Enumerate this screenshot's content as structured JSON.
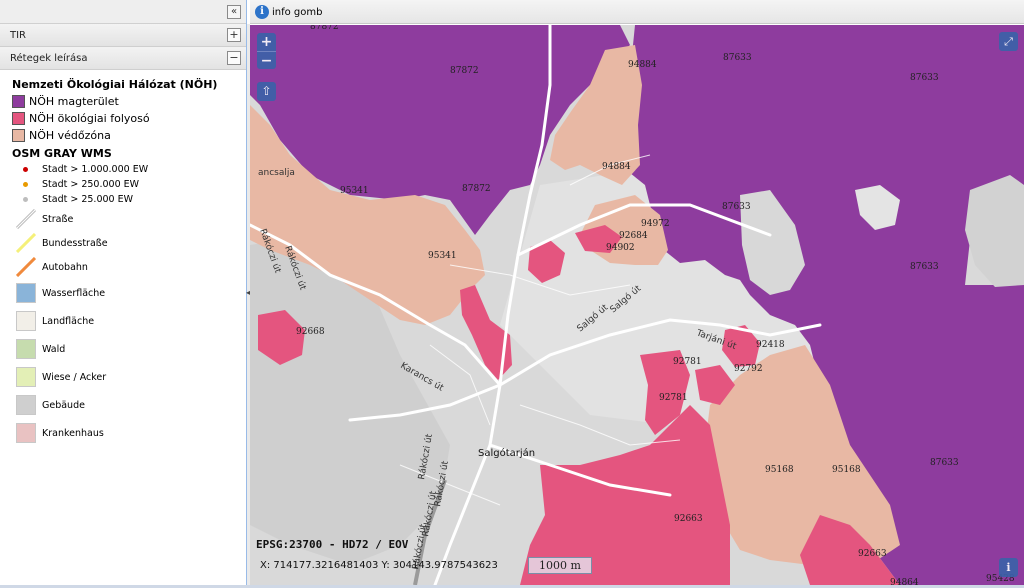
{
  "panel": {
    "collapse_icon": "«",
    "sections": [
      {
        "label": "TIR",
        "toggle": "+"
      },
      {
        "label": "Rétegek leírása",
        "toggle": "−"
      }
    ]
  },
  "legend": {
    "noh_title": "Nemzeti Ökológiai Hálózat (NÖH)",
    "noh_items": [
      {
        "label": "NÖH magterület",
        "color": "#8e3c9e"
      },
      {
        "label": "NÖH ökológiai folyosó",
        "color": "#e4557f"
      },
      {
        "label": "NÖH védőzóna",
        "color": "#e8b8a4"
      }
    ],
    "osm_title": "OSM GRAY WMS",
    "osm_items": [
      {
        "label": "Stadt > 1.000.000 EW",
        "symbol": "dot",
        "color": "#cc0000"
      },
      {
        "label": "Stadt > 250.000 EW",
        "symbol": "dot",
        "color": "#e89a00"
      },
      {
        "label": "Stadt > 25.000 EW",
        "symbol": "dot",
        "color": "#bdbdbd"
      },
      {
        "label": "Straße",
        "symbol": "line",
        "color": "#bbbbbb"
      },
      {
        "label": "Bundesstraße",
        "symbol": "line",
        "color": "#f5f07a"
      },
      {
        "label": "Autobahn",
        "symbol": "line",
        "color": "#f08a3c"
      },
      {
        "label": "Wasserfläche",
        "symbol": "square",
        "color": "#8ab4d9"
      },
      {
        "label": "Landfläche",
        "symbol": "square",
        "color": "#f2efe8"
      },
      {
        "label": "Wald",
        "symbol": "square",
        "color": "#c6dcae"
      },
      {
        "label": "Wiese / Acker",
        "symbol": "square",
        "color": "#e3efb6"
      },
      {
        "label": "Gebäude",
        "symbol": "square",
        "color": "#cfcfcf"
      },
      {
        "label": "Krankenhaus",
        "symbol": "square",
        "color": "#e9c2c2"
      }
    ]
  },
  "toolbar": {
    "info_label": "info gomb",
    "info_icon": "info-icon"
  },
  "map": {
    "zoom_in": "+",
    "zoom_out": "−",
    "home_icon": "⇧",
    "fullscreen_icon": "⤢",
    "info_icon": "i",
    "crs": "EPSG:23700 - HD72 / EOV",
    "coords": "X: 714177.3216481403 Y: 304143.9787543623",
    "scale": "1000 m",
    "labels": [
      "87872",
      "87872",
      "87872",
      "94884",
      "94884",
      "87633",
      "87633",
      "87633",
      "87633",
      "87633",
      "95341",
      "95341",
      "92684",
      "94972",
      "94902",
      "92668",
      "92418",
      "92781",
      "92781",
      "92792",
      "95168",
      "95168",
      "92663",
      "92663",
      "94864",
      "95428"
    ],
    "place_labels": [
      "Salgótarján",
      "Salgó út",
      "Salgó út",
      "Tarjáni út",
      "Karancs út",
      "Rákóczi út",
      "Rákóczi út",
      "Rákóczi út",
      "Rákóczi út",
      "Rákóczi út",
      "Rákóczi út",
      "ancsalja"
    ]
  }
}
